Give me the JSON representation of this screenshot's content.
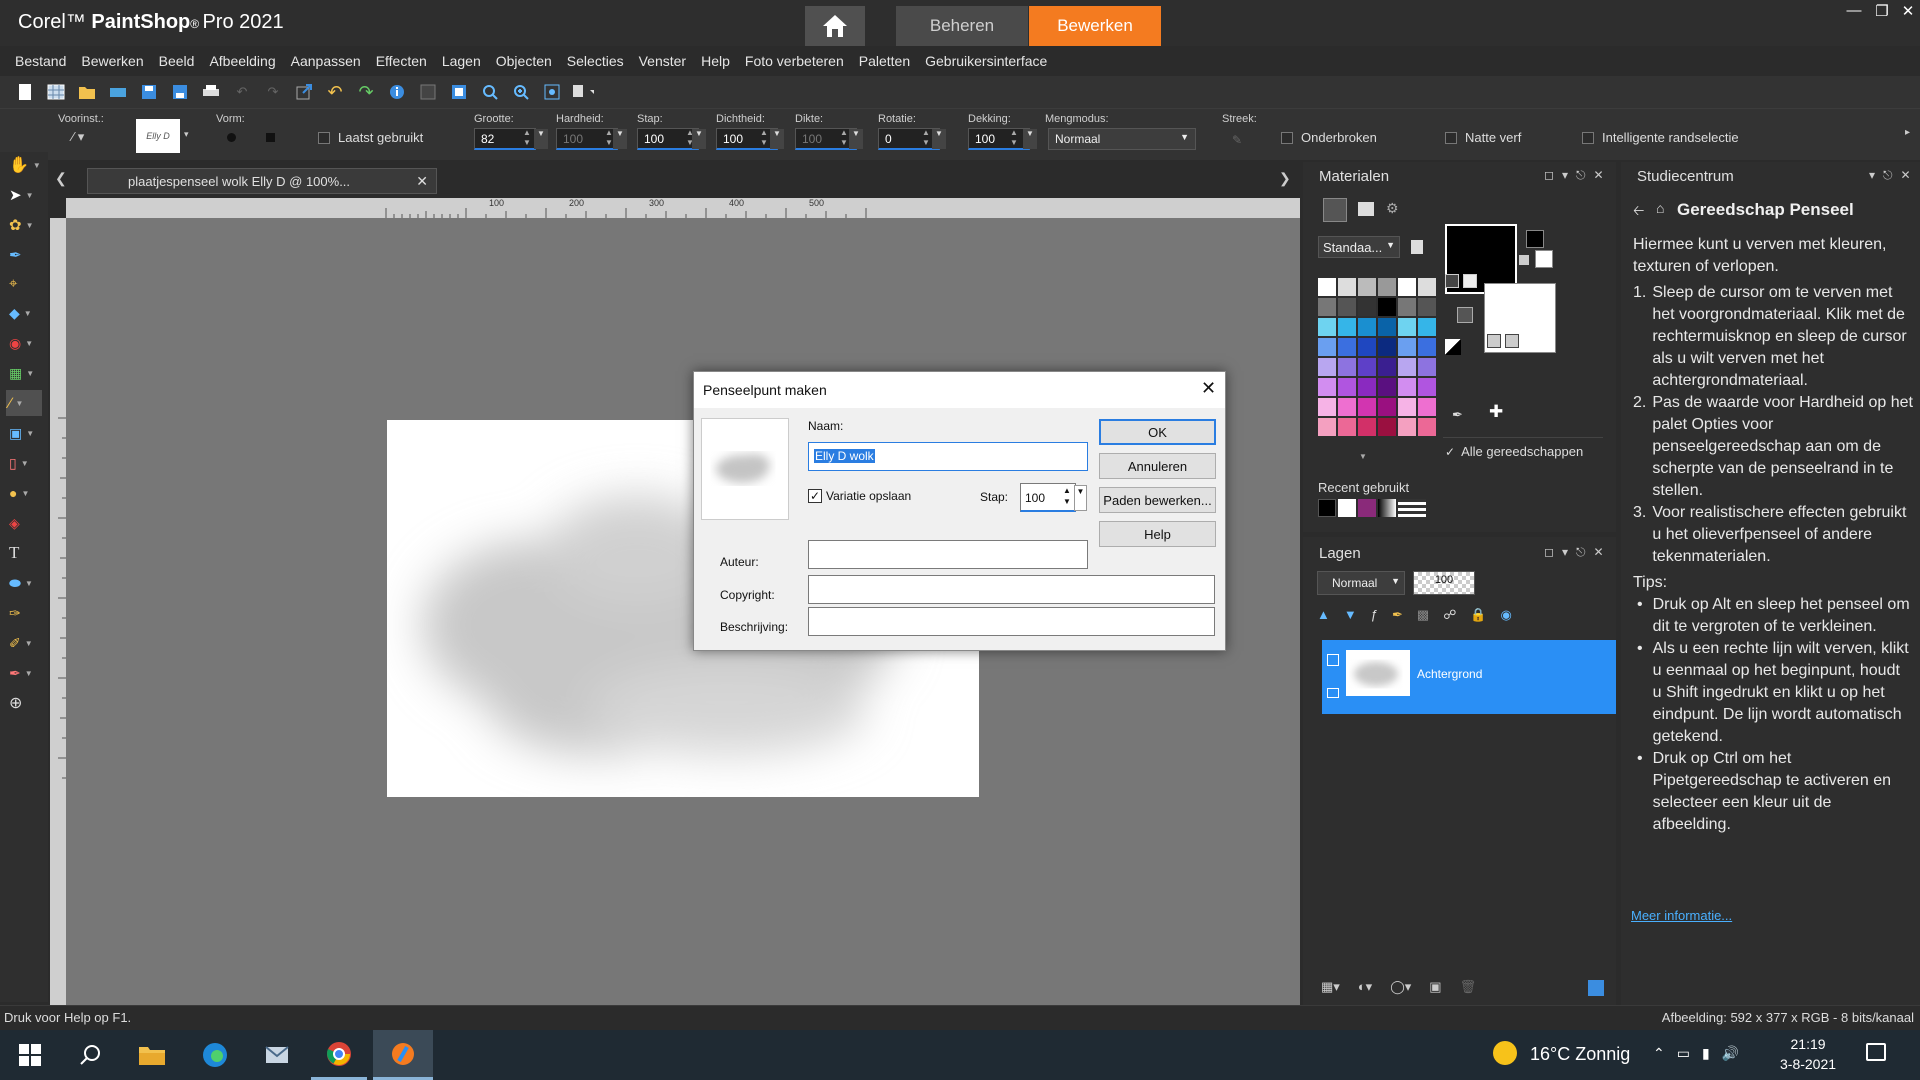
{
  "app": {
    "title_prefix": "Corel",
    "title_main": "PaintShop",
    "title_suffix": "Pro 2021",
    "tabs": [
      {
        "label": "Beheren"
      },
      {
        "label": "Bewerken"
      }
    ],
    "accent_color": "#f47b20"
  },
  "menu": [
    "Bestand",
    "Bewerken",
    "Beeld",
    "Afbeelding",
    "Aanpassen",
    "Effecten",
    "Lagen",
    "Objecten",
    "Selecties",
    "Venster",
    "Help",
    "Foto verbeteren",
    "Paletten",
    "Gebruikersinterface"
  ],
  "options": {
    "preset_label": "Voorinst.:",
    "preset_thumb": "Elly D",
    "shape_label": "Vorm:",
    "last_used": "Laatst gebruikt",
    "size_label": "Grootte:",
    "size": "82",
    "hardness_label": "Hardheid:",
    "hardness": "100",
    "step_label": "Stap:",
    "step": "100",
    "density_label": "Dichtheid:",
    "density": "100",
    "thickness_label": "Dikte:",
    "thickness": "100",
    "rotation_label": "Rotatie:",
    "rotation": "0",
    "opacity_label": "Dekking:",
    "opacity": "100",
    "blend_label": "Mengmodus:",
    "blend": "Normaal",
    "stroke_label": "Streek:",
    "continuous": "Onderbroken",
    "wet_paint": "Natte verf",
    "smart_edge": "Intelligente randselectie"
  },
  "document": {
    "tab_title": "plaatjespenseel wolk  Elly D @ 100%...",
    "ruler_marks": [
      "100",
      "200",
      "300",
      "400",
      "500"
    ]
  },
  "dialog": {
    "title": "Penseelpunt maken",
    "name_label": "Naam:",
    "name_value": "Elly D  wolk",
    "variation_label": "Variatie opslaan",
    "variation_checked": true,
    "step_label": "Stap:",
    "step_value": "100",
    "author_label": "Auteur:",
    "copyright_label": "Copyright:",
    "description_label": "Beschrijving:",
    "buttons": {
      "ok": "OK",
      "cancel": "Annuleren",
      "edit_paths": "Paden bewerken...",
      "help": "Help"
    }
  },
  "materials": {
    "title": "Materialen",
    "dropdown": "Standaa...",
    "all_tools": "Alle gereedschappen",
    "recent_label": "Recent gebruikt"
  },
  "layers": {
    "title": "Lagen",
    "blend": "Normaal",
    "opacity": "100",
    "layer_name": "Achtergrond"
  },
  "studio": {
    "title": "Studiecentrum",
    "heading": "Gereedschap Penseel",
    "intro": "Hiermee kunt u verven met kleuren, texturen of verlopen.",
    "steps": [
      "Sleep de cursor om te verven met het voorgrondmateriaal. Klik met de rechtermuisknop en sleep de cursor als u wilt verven met het achtergrondmateriaal.",
      "Pas de waarde voor Hardheid op het palet Opties voor penseelgereedschap aan om de scherpte van de penseelrand in te stellen.",
      "Voor realistischere effecten gebruikt u het olieverfpenseel of andere tekenmaterialen."
    ],
    "tips_label": "Tips:",
    "tips": [
      "Druk op Alt en sleep het penseel om dit te vergroten of te verkleinen.",
      "Als u een rechte lijn wilt verven, klikt u eenmaal op het beginpunt, houdt u Shift ingedrukt en klikt u op het eindpunt. De lijn wordt automatisch getekend.",
      "Druk op Ctrl om het Pipetgereedschap te activeren en selecteer een kleur uit de afbeelding."
    ],
    "more_info": "Meer informatie..."
  },
  "status": {
    "help": "Druk voor Help op F1.",
    "image_info": "Afbeelding:  592 x 377 x RGB - 8 bits/kanaal"
  },
  "taskbar": {
    "weather": "16°C  Zonnig",
    "time": "21:19",
    "date": "3-8-2021"
  }
}
